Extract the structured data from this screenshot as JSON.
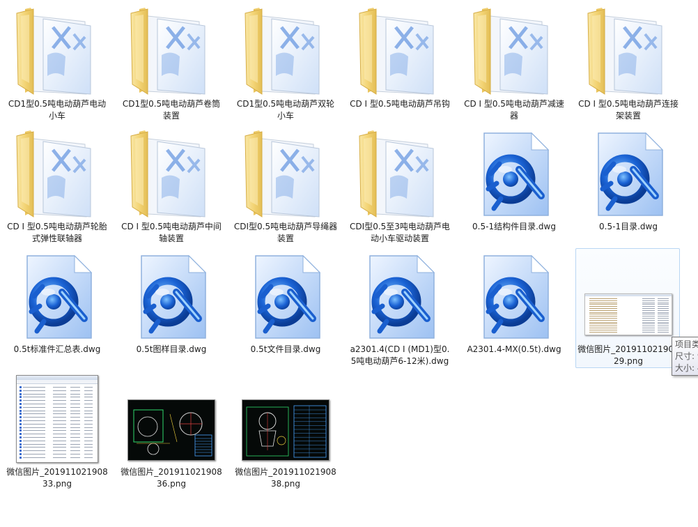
{
  "items": [
    {
      "name": "CD1型0.5吨电动葫芦电动小车",
      "kind": "folder"
    },
    {
      "name": "CD1型0.5吨电动葫芦卷筒装置",
      "kind": "folder"
    },
    {
      "name": "CD1型0.5吨电动葫芦双轮小车",
      "kind": "folder"
    },
    {
      "name": "CD I 型0.5吨电动葫芦吊钩",
      "kind": "folder"
    },
    {
      "name": "CD I 型0.5吨电动葫芦减速器",
      "kind": "folder"
    },
    {
      "name": "CD I 型0.5吨电动葫芦连接架装置",
      "kind": "folder"
    },
    {
      "name": "CD I 型0.5吨电动葫芦轮胎式弹性联轴器",
      "kind": "folder"
    },
    {
      "name": "CD I 型0.5吨电动葫芦中间轴装置",
      "kind": "folder"
    },
    {
      "name": "CDI型0.5吨电动葫芦导绳器装置",
      "kind": "folder"
    },
    {
      "name": "CDI型0.5至3吨电动葫芦电动小车驱动装置",
      "kind": "folder"
    },
    {
      "name": "0.5-1结构件目录.dwg",
      "kind": "dwg"
    },
    {
      "name": "0.5-1目录.dwg",
      "kind": "dwg"
    },
    {
      "name": "0.5t标准件汇总表.dwg",
      "kind": "dwg"
    },
    {
      "name": "0.5t图样目录.dwg",
      "kind": "dwg"
    },
    {
      "name": "0.5t文件目录.dwg",
      "kind": "dwg"
    },
    {
      "name": "a2301.4(CD I (MD1)型0.5吨电动葫芦6-12米).dwg",
      "kind": "dwg"
    },
    {
      "name": "A2301.4-MX(0.5t).dwg",
      "kind": "dwg"
    },
    {
      "name": "微信图片_20191102190829.png",
      "kind": "png-wide",
      "hovered": true
    },
    {
      "name": "微信图片_20191102190833.png",
      "kind": "png-list"
    },
    {
      "name": "微信图片_20191102190836.png",
      "kind": "png-cad1"
    },
    {
      "name": "微信图片_20191102190838.png",
      "kind": "png-cad2"
    }
  ],
  "tooltip": {
    "line1": "项目类",
    "line2": "尺寸: 9",
    "line3": "大小: 4"
  },
  "colors": {
    "folder_yellow": "#f5d77a",
    "dwg_blue": "#2b6fd6",
    "hover_border": "#b9d6f3"
  }
}
